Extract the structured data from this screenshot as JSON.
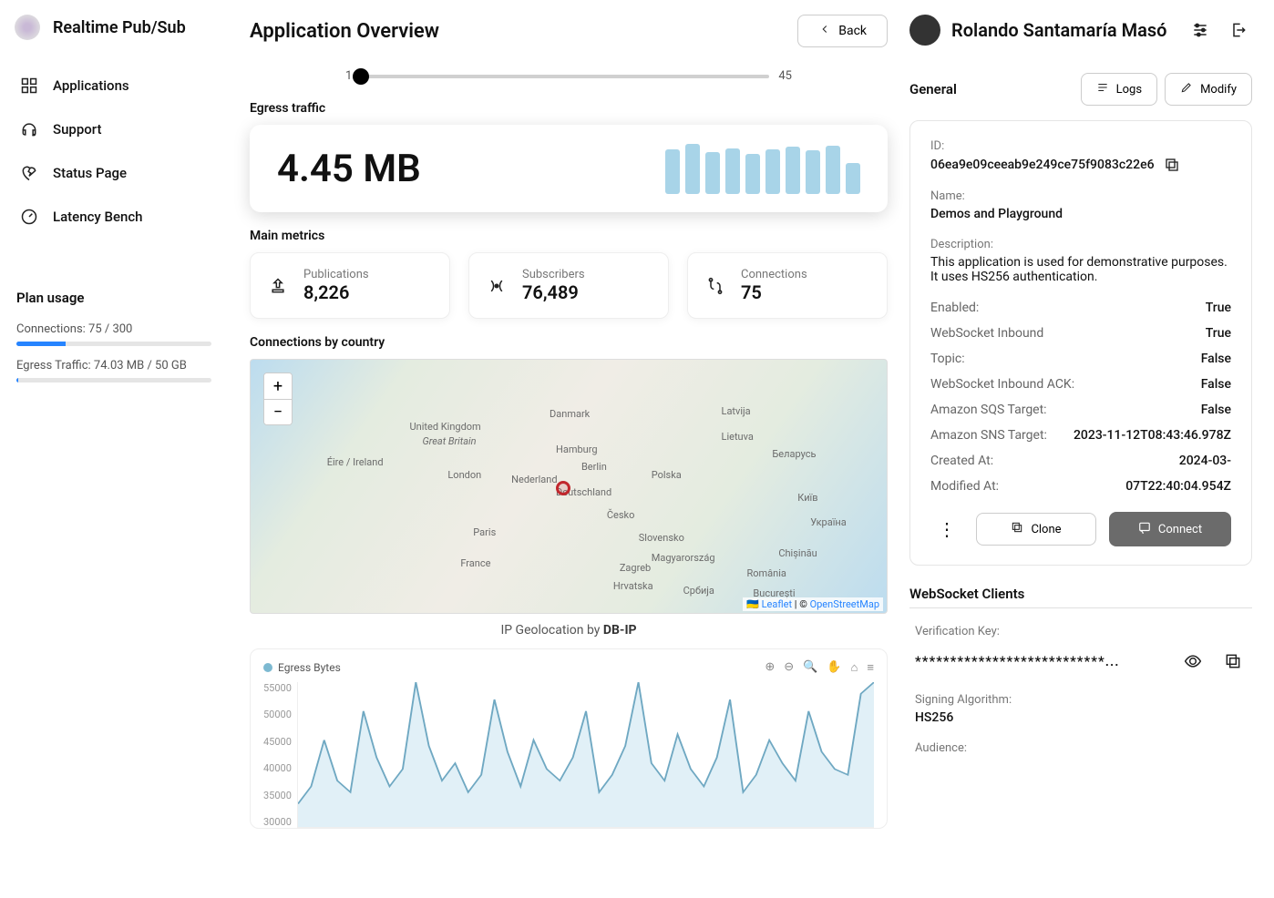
{
  "brand": "Realtime Pub/Sub",
  "nav": [
    {
      "label": "Applications"
    },
    {
      "label": "Support"
    },
    {
      "label": "Status Page"
    },
    {
      "label": "Latency Bench"
    }
  ],
  "plan": {
    "title": "Plan usage",
    "connections": "Connections: 75 / 300",
    "egress": "Egress Traffic: 74.03 MB / 50 GB"
  },
  "page": {
    "title": "Application Overview",
    "back": "Back"
  },
  "slider": {
    "min": "1",
    "max": "45"
  },
  "egress": {
    "title": "Egress traffic",
    "value": "4.45 MB"
  },
  "metrics": {
    "title": "Main metrics",
    "cards": [
      {
        "label": "Publications",
        "value": "8,226"
      },
      {
        "label": "Subscribers",
        "value": "76,489"
      },
      {
        "label": "Connections",
        "value": "75"
      }
    ]
  },
  "map": {
    "title": "Connections by country",
    "caption_prefix": "IP Geolocation by ",
    "caption_link": "DB-IP",
    "attrib_leaflet": "Leaflet",
    "attrib_sep": " | © ",
    "attrib_osm": "OpenStreetMap",
    "labels": {
      "uk": "United Kingdom",
      "gb": "Great Britain",
      "ie": "Éire / Ireland",
      "nl": "Nederland",
      "de": "Deutschland",
      "dk": "Danmark",
      "pl": "Polska",
      "fr": "France",
      "paris": "Paris",
      "london": "London",
      "berlin": "Berlin",
      "hamburg": "Hamburg",
      "lt": "Lietuva",
      "lv": "Latvija",
      "by": "Беларусь",
      "ua": "Україна",
      "kyiv": "Київ",
      "cz": "Česko",
      "sk": "Slovensko",
      "hu": "Magyarország",
      "ro": "România",
      "hr": "Hrvatska",
      "rs": "Србија",
      "md": "Chișinău",
      "bu": "București",
      "zg": "Zagreb"
    }
  },
  "chart": {
    "legend": "Egress Bytes",
    "yticks": [
      "55000",
      "50000",
      "45000",
      "40000",
      "35000",
      "30000"
    ]
  },
  "chart_data": {
    "type": "line",
    "title": "",
    "xlabel": "",
    "ylabel": "Egress Bytes",
    "ylim": [
      30000,
      55000
    ],
    "series": [
      {
        "name": "Egress Bytes",
        "values": [
          34000,
          37000,
          45000,
          38000,
          36000,
          50000,
          42000,
          37000,
          40000,
          55000,
          44000,
          38000,
          41000,
          36000,
          39000,
          52000,
          43000,
          37000,
          45000,
          40000,
          38000,
          42000,
          50000,
          36000,
          39000,
          44000,
          55000,
          41000,
          38000,
          46000,
          40000,
          37000,
          42000,
          52000,
          36000,
          39000,
          45000,
          41000,
          38000,
          50000,
          43000,
          40000,
          39000,
          53000,
          55000
        ]
      }
    ]
  },
  "user": {
    "name": "Rolando Santamaría Masó"
  },
  "panel": {
    "tab": "General",
    "logs": "Logs",
    "modify": "Modify",
    "clone": "Clone",
    "connect": "Connect"
  },
  "details": {
    "id_label": "ID:",
    "id": "06ea9e09ceeab9e249ce75f9083c22e6",
    "name_label": "Name:",
    "name": "Demos and Playground",
    "desc_label": "Description:",
    "desc": "This application is used for demonstrative purposes. It uses HS256 authentication.",
    "rows": [
      {
        "k": "Enabled:",
        "v": "True"
      },
      {
        "k": "WebSocket Inbound",
        "v": "True"
      },
      {
        "k": "Topic:",
        "v": "False"
      },
      {
        "k": "WebSocket Inbound ACK:",
        "v": "False"
      },
      {
        "k": "Amazon SQS Target:",
        "v": "False"
      },
      {
        "k": "Amazon SNS Target:",
        "v": "2023-11-12T08:43:46.978Z"
      },
      {
        "k": "Created At:",
        "v": "2024-03-"
      },
      {
        "k": "Modified At:",
        "v": "07T22:40:04.954Z"
      }
    ]
  },
  "ws": {
    "title": "WebSocket Clients",
    "vkey_label": "Verification Key:",
    "vkey": "***************************...",
    "algo_label": "Signing Algorithm:",
    "algo": "HS256",
    "aud_label": "Audience:"
  }
}
